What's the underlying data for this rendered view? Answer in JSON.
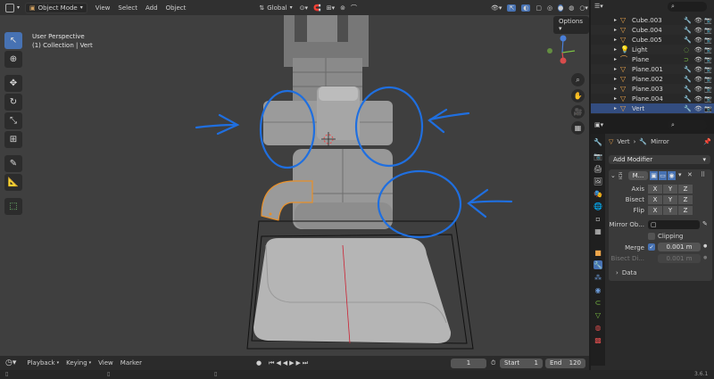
{
  "header": {
    "mode": "Object Mode",
    "menus": [
      "View",
      "Select",
      "Add",
      "Object"
    ],
    "transform_orientation": "Global",
    "options_label": "Options"
  },
  "viewport": {
    "perspective": "User Perspective",
    "collection": "(1) Collection | Vert",
    "gizmo_axes": [
      "Z",
      "Y",
      "X"
    ]
  },
  "outliner": {
    "items": [
      {
        "name": "Cube.003",
        "type": "mesh"
      },
      {
        "name": "Cube.004",
        "type": "mesh"
      },
      {
        "name": "Cube.005",
        "type": "mesh"
      },
      {
        "name": "Light",
        "type": "light"
      },
      {
        "name": "Plane",
        "type": "curve"
      },
      {
        "name": "Plane.001",
        "type": "mesh"
      },
      {
        "name": "Plane.002",
        "type": "mesh"
      },
      {
        "name": "Plane.003",
        "type": "mesh"
      },
      {
        "name": "Plane.004",
        "type": "mesh"
      },
      {
        "name": "Vert",
        "type": "mesh",
        "selected": true
      }
    ]
  },
  "properties": {
    "breadcrumb_object": "Vert",
    "breadcrumb_modifier": "Mirror",
    "add_modifier_label": "Add Modifier",
    "modifier_name": "M...",
    "axis_label": "Axis",
    "bisect_label": "Bisect",
    "flip_label": "Flip",
    "axis_buttons": [
      "X",
      "Y",
      "Z"
    ],
    "mirror_object_label": "Mirror Ob...",
    "clipping_label": "Clipping",
    "merge_label": "Merge",
    "merge_value": "0.001 m",
    "bisect_distance_label": "Bisect Di...",
    "bisect_distance_value": "0.001 m",
    "data_label": "Data"
  },
  "timeline": {
    "menus": [
      "Playback",
      "Keying",
      "View",
      "Marker"
    ],
    "current_frame": "1",
    "start_label": "Start",
    "start_value": "1",
    "end_label": "End",
    "end_value": "120"
  },
  "statusbar": {
    "version": "3.6.1"
  },
  "colors": {
    "accent": "#4772b3",
    "annotation_blue": "#1f6fe0",
    "selection_orange": "#e8902a"
  }
}
